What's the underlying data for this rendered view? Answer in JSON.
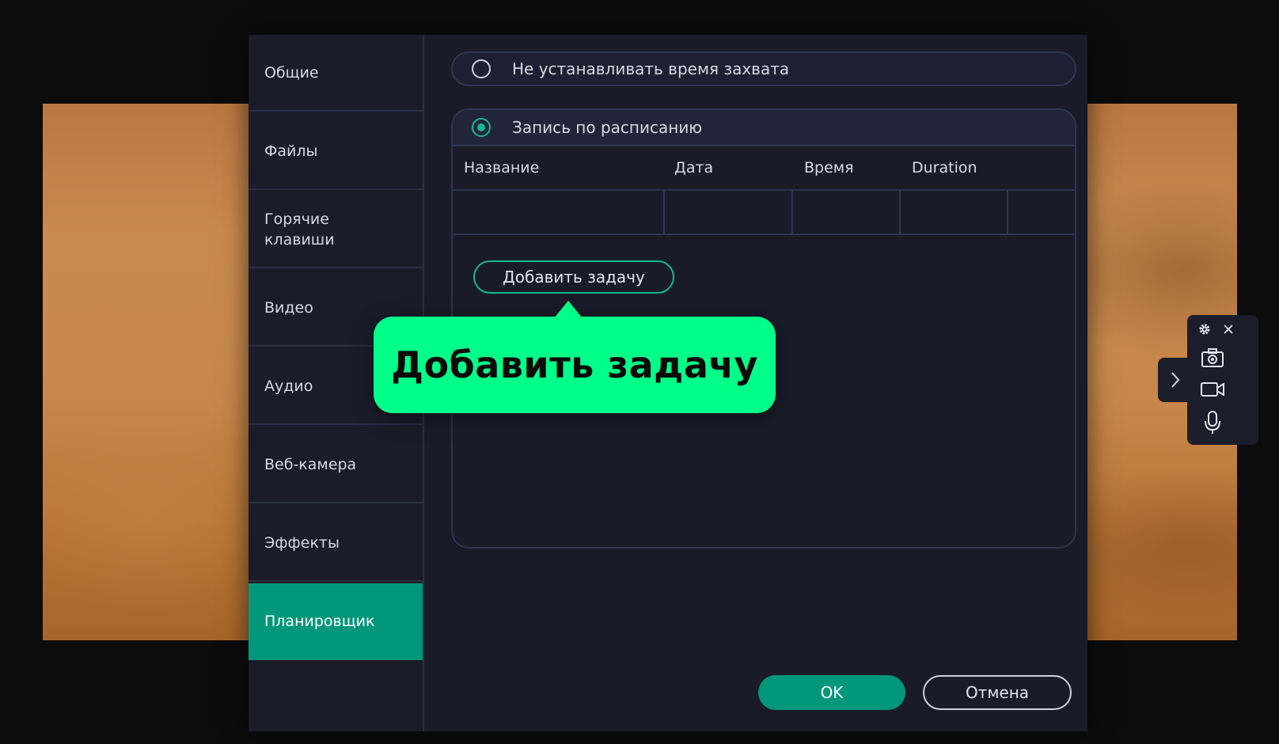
{
  "sidebar": {
    "items": [
      {
        "label": "Общие"
      },
      {
        "label": "Файлы"
      },
      {
        "label": "Горячие\nклавиши"
      },
      {
        "label": "Видео"
      },
      {
        "label": "Аудио"
      },
      {
        "label": "Веб-камера"
      },
      {
        "label": "Эффекты"
      },
      {
        "label": "Планировщик",
        "active": true
      }
    ]
  },
  "main": {
    "option_no_time": "Не устанавливать время захвата",
    "option_schedule": "Запись по расписанию",
    "table": {
      "columns": [
        "Название",
        "Дата",
        "Время",
        "Duration"
      ]
    },
    "add_task_label": "Добавить задачу"
  },
  "footer": {
    "ok_label": "OK",
    "cancel_label": "Отмена"
  },
  "callout": {
    "text": "Добавить задачу"
  },
  "widget": {
    "icons": [
      "gear-icon",
      "close-icon",
      "camera-icon",
      "video-camera-icon",
      "microphone-icon",
      "chevron-right-icon"
    ]
  },
  "colors": {
    "accent": "#00977a",
    "callout": "#00ff89",
    "dialog_bg": "#191b29"
  }
}
